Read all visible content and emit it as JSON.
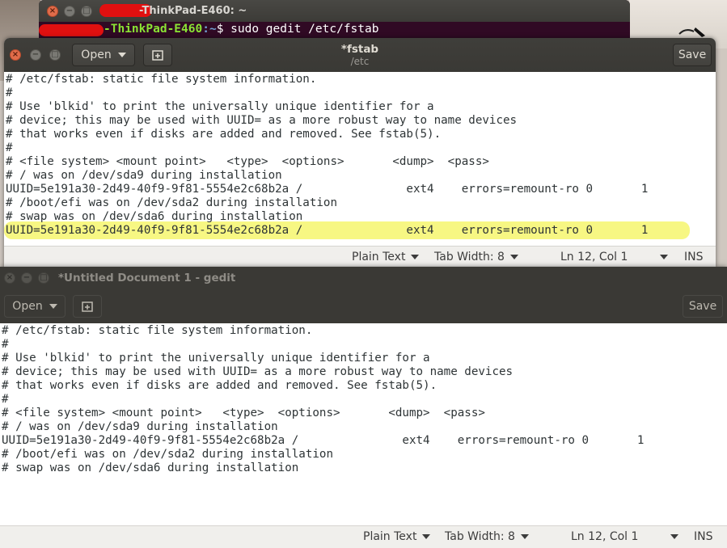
{
  "terminal": {
    "title_suffix": "-ThinkPad-E460: ~",
    "prompt_host": "-ThinkPad-E460",
    "prompt_path": ":~",
    "prompt_symbol": "$",
    "command": " sudo gedit /etc/fstab"
  },
  "window1": {
    "title": "*fstab",
    "subtitle": "/etc",
    "open_label": "Open",
    "save_label": "Save",
    "lines": [
      "# /etc/fstab: static file system information.",
      "#",
      "# Use 'blkid' to print the universally unique identifier for a",
      "# device; this may be used with UUID= as a more robust way to name devices",
      "# that works even if disks are added and removed. See fstab(5).",
      "#",
      "# <file system> <mount point>   <type>  <options>       <dump>  <pass>",
      "# / was on /dev/sda9 during installation",
      "UUID=5e191a30-2d49-40f9-9f81-5554e2c68b2a /               ext4    errors=remount-ro 0       1",
      "# /boot/efi was on /dev/sda2 during installation",
      "# swap was on /dev/sda6 during installation",
      "UUID=5e191a30-2d49-40f9-9f81-5554e2c68b2a /               ext4    errors=remount-ro 0       1"
    ],
    "status": {
      "syntax": "Plain Text",
      "tab_width": "Tab Width: 8",
      "position": "Ln 12, Col 1",
      "mode": "INS"
    }
  },
  "window2": {
    "title": "*Untitled Document 1 - gedit",
    "open_label": "Open",
    "save_label": "Save",
    "lines": [
      "# /etc/fstab: static file system information.",
      "#",
      "# Use 'blkid' to print the universally unique identifier for a",
      "# device; this may be used with UUID= as a more robust way to name devices",
      "# that works even if disks are added and removed. See fstab(5).",
      "#",
      "# <file system> <mount point>   <type>  <options>       <dump>  <pass>",
      "# / was on /dev/sda9 during installation",
      "UUID=5e191a30-2d49-40f9-9f81-5554e2c68b2a /               ext4    errors=remount-ro 0       1",
      "# /boot/efi was on /dev/sda2 during installation",
      "# swap was on /dev/sda6 during installation"
    ],
    "status": {
      "syntax": "Plain Text",
      "tab_width": "Tab Width: 8",
      "position": "Ln 12, Col 1",
      "mode": "INS"
    }
  },
  "colors": {
    "highlight": "#f7f77c",
    "terminal_bg": "#300a24",
    "header_bg": "#3c3b37",
    "prompt_host": "#8ae234",
    "prompt_path": "#729fcf",
    "redaction": "#e01010"
  }
}
